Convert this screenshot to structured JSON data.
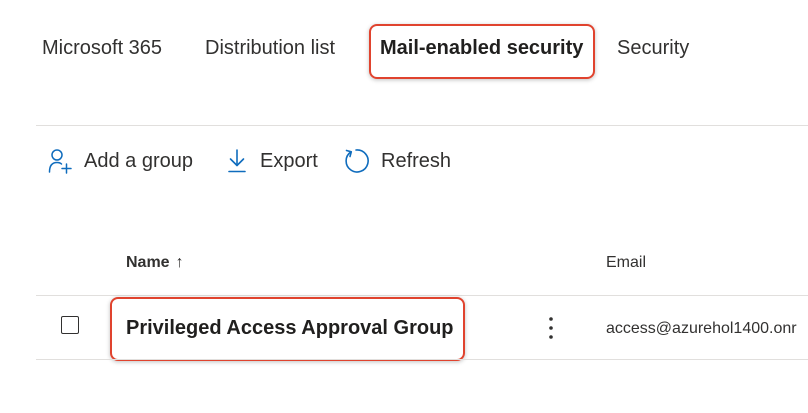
{
  "tabs": [
    {
      "label": "Microsoft 365",
      "selected": false
    },
    {
      "label": "Distribution list",
      "selected": false
    },
    {
      "label": "Mail-enabled security",
      "selected": true
    },
    {
      "label": "Security",
      "selected": false
    }
  ],
  "toolbar": {
    "add_group_label": "Add a group",
    "export_label": "Export",
    "refresh_label": "Refresh",
    "add_group_icon": "add-person-icon",
    "export_icon": "download-icon",
    "refresh_icon": "refresh-icon"
  },
  "table": {
    "columns": {
      "name": "Name",
      "name_sort_indicator": "↑",
      "email": "Email"
    },
    "rows": [
      {
        "name": "Privileged Access Approval Group",
        "email": "access@azurehol1400.onr",
        "selected": false
      }
    ]
  },
  "colors": {
    "accent": "#0f6cbd",
    "highlight": "#e0432e",
    "divider": "#e1dfdd",
    "text": "#323130"
  }
}
